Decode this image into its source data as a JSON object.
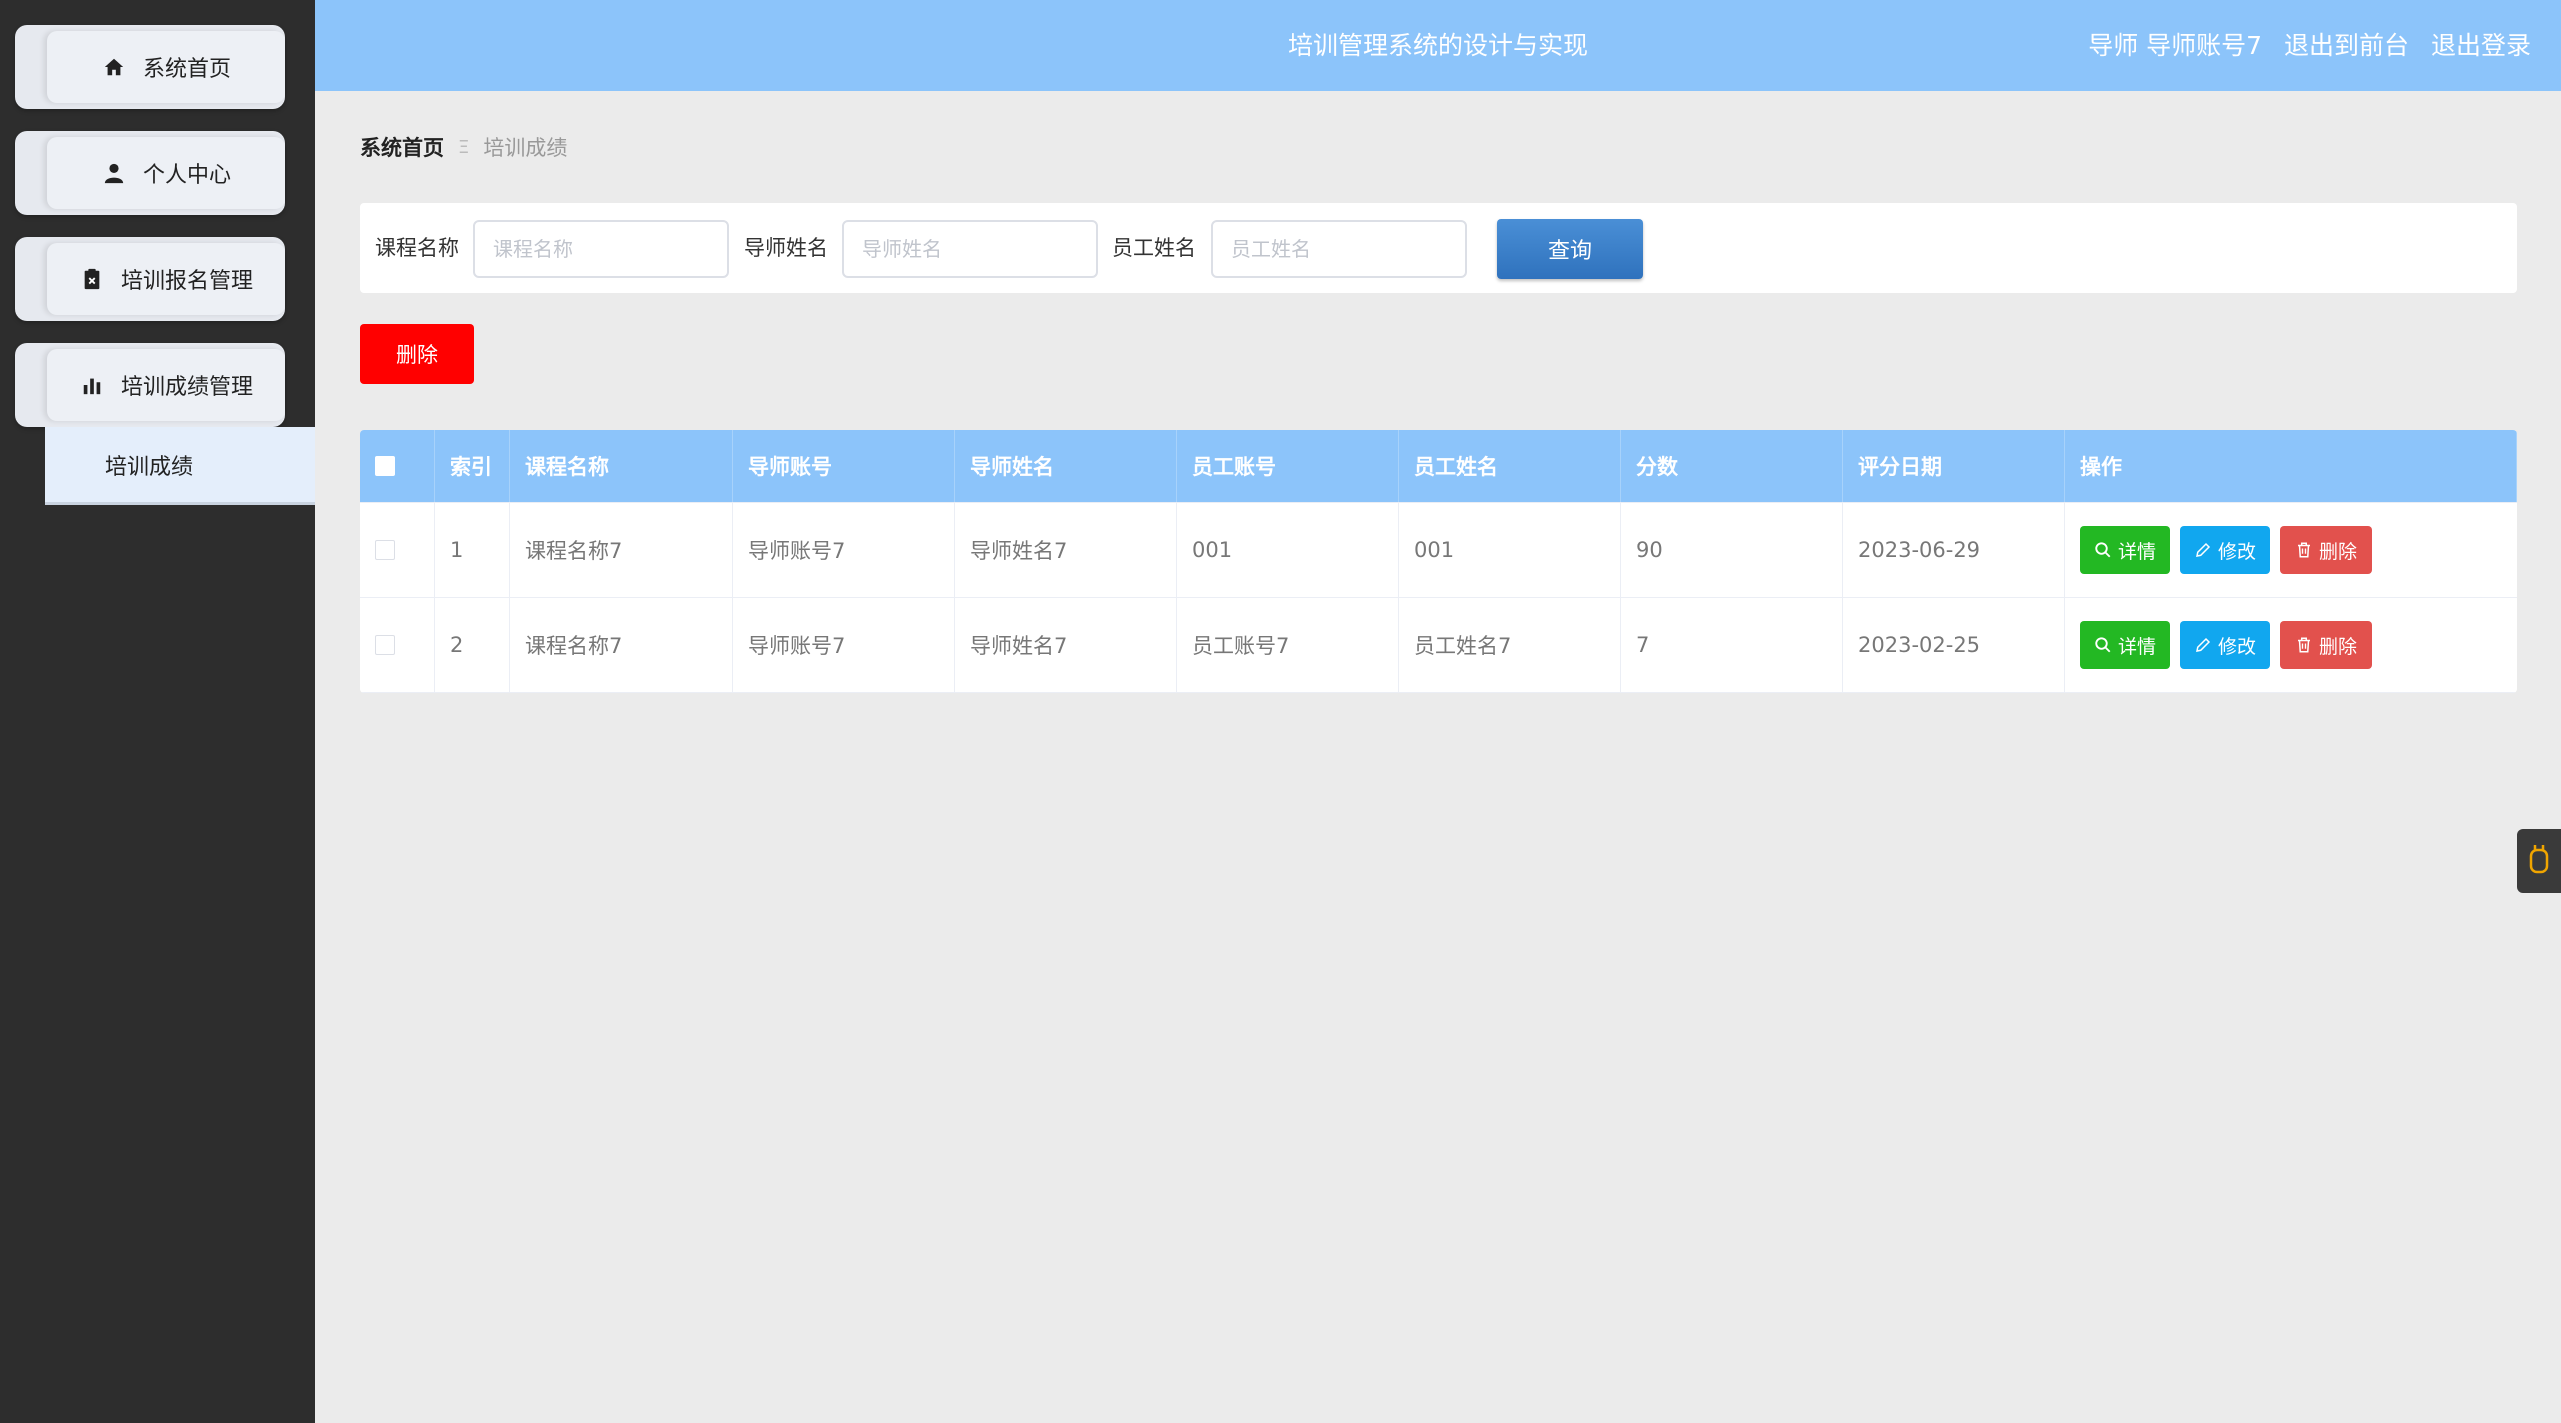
{
  "sidebar": {
    "items": [
      {
        "label": "系统首页",
        "icon": "home-icon"
      },
      {
        "label": "个人中心",
        "icon": "user-icon"
      },
      {
        "label": "培训报名管理",
        "icon": "clipboard-icon"
      },
      {
        "label": "培训成绩管理",
        "icon": "bar-chart-icon"
      }
    ],
    "submenu": {
      "label": "培训成绩"
    }
  },
  "header": {
    "title": "培训管理系统的设计与实现",
    "user": "导师 导师账号7",
    "to_front": "退出到前台",
    "logout": "退出登录"
  },
  "breadcrumb": {
    "home": "系统首页",
    "separator": "Ξ",
    "current": "培训成绩"
  },
  "search": {
    "course_label": "课程名称",
    "course_placeholder": "课程名称",
    "teacher_label": "导师姓名",
    "teacher_placeholder": "导师姓名",
    "employee_label": "员工姓名",
    "employee_placeholder": "员工姓名",
    "query_button": "查询"
  },
  "actions": {
    "delete_button": "删除"
  },
  "table": {
    "columns": [
      "索引",
      "课程名称",
      "导师账号",
      "导师姓名",
      "员工账号",
      "员工姓名",
      "分数",
      "评分日期",
      "操作"
    ],
    "rows": [
      {
        "index": "1",
        "course": "课程名称7",
        "teacher_account": "导师账号7",
        "teacher_name": "导师姓名7",
        "employee_account": "001",
        "employee_name": "001",
        "score": "90",
        "date": "2023-06-29"
      },
      {
        "index": "2",
        "course": "课程名称7",
        "teacher_account": "导师账号7",
        "teacher_name": "导师姓名7",
        "employee_account": "员工账号7",
        "employee_name": "员工姓名7",
        "score": "7",
        "date": "2023-02-25"
      }
    ],
    "row_actions": {
      "detail": "详情",
      "edit": "修改",
      "delete": "删除"
    }
  },
  "colors": {
    "header_bg": "#8cc4fa",
    "sidebar_bg": "#2d2d2d",
    "detail_btn": "#23b823",
    "edit_btn": "#11a7ef",
    "delete_btn": "#e2514d",
    "bulk_delete_btn": "#ff0000",
    "query_btn": "#3a80c9"
  }
}
